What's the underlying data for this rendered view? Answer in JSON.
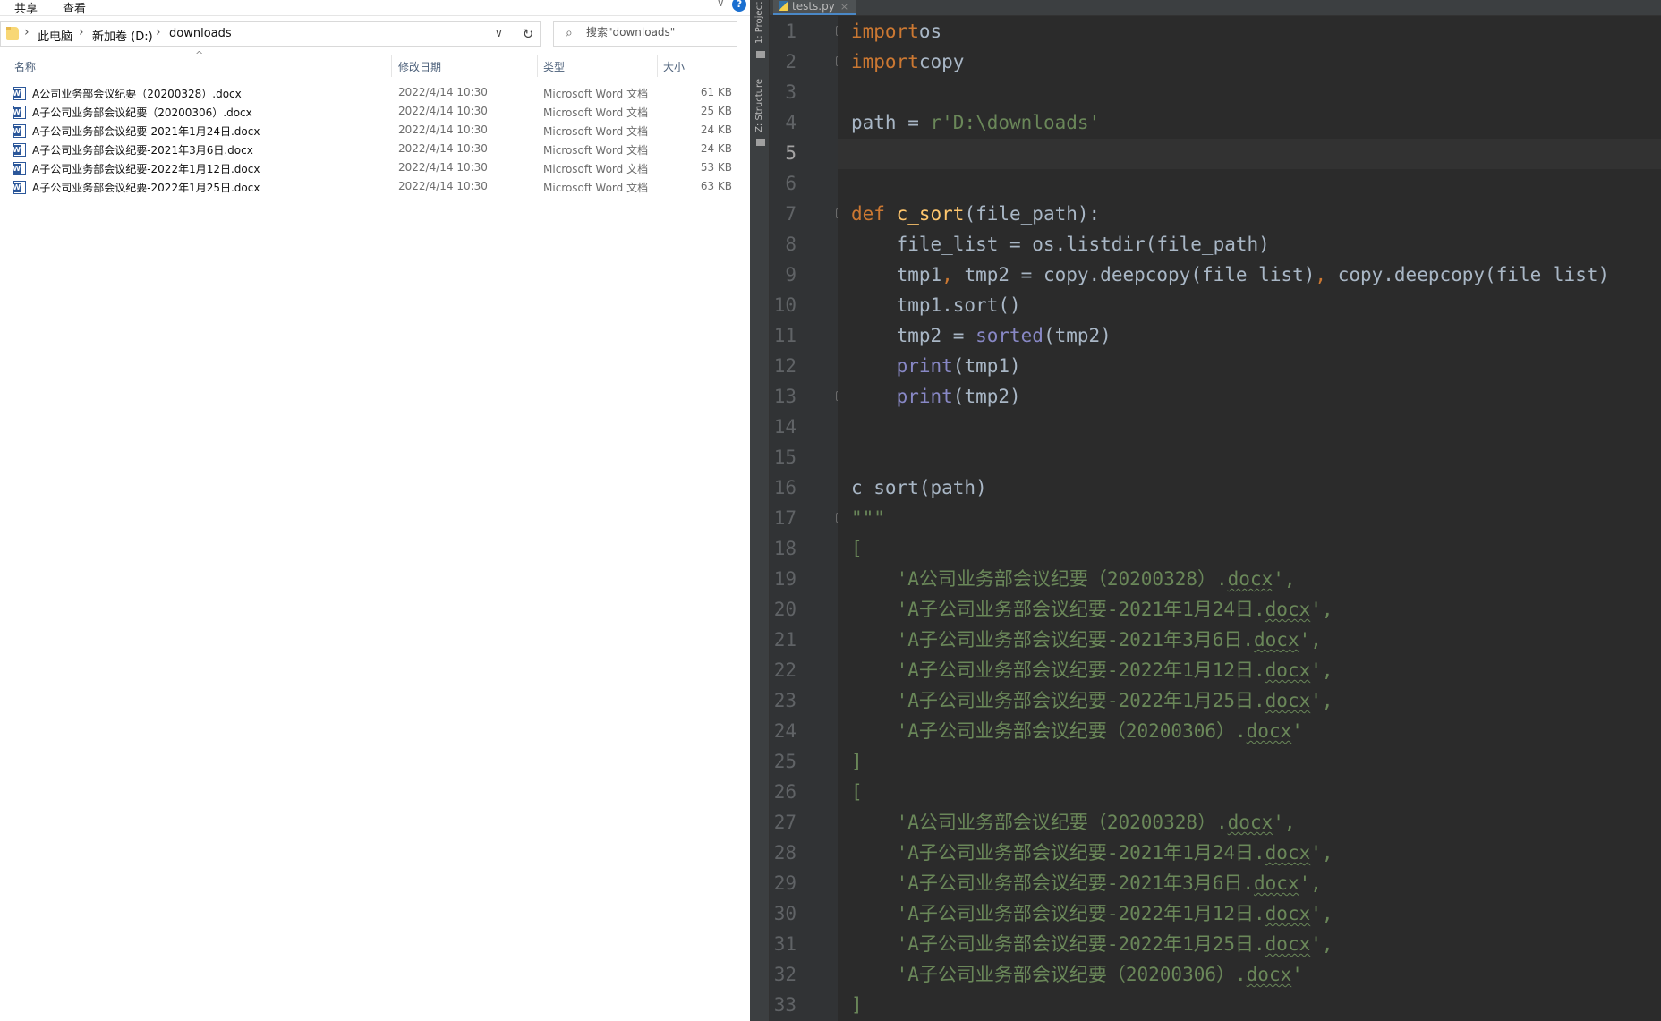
{
  "explorer": {
    "ribbon": {
      "tab_share": "共享",
      "tab_view": "查看",
      "help_glyph": "?"
    },
    "address": {
      "seg_pc": "此电脑",
      "seg_drive": "新加卷 (D:)",
      "seg_folder": "downloads"
    },
    "search": {
      "placeholder": "搜索\"downloads\""
    },
    "columns": {
      "name": "名称",
      "date": "修改日期",
      "type": "类型",
      "size": "大小"
    },
    "files": [
      {
        "name": "A公司业务部会议纪要（20200328）.docx",
        "date": "2022/4/14 10:30",
        "type": "Microsoft Word 文档",
        "size": "61 KB"
      },
      {
        "name": "A子公司业务部会议纪要（20200306）.docx",
        "date": "2022/4/14 10:30",
        "type": "Microsoft Word 文档",
        "size": "25 KB"
      },
      {
        "name": "A子公司业务部会议纪要-2021年1月24日.docx",
        "date": "2022/4/14 10:30",
        "type": "Microsoft Word 文档",
        "size": "24 KB"
      },
      {
        "name": "A子公司业务部会议纪要-2021年3月6日.docx",
        "date": "2022/4/14 10:30",
        "type": "Microsoft Word 文档",
        "size": "24 KB"
      },
      {
        "name": "A子公司业务部会议纪要-2022年1月12日.docx",
        "date": "2022/4/14 10:30",
        "type": "Microsoft Word 文档",
        "size": "53 KB"
      },
      {
        "name": "A子公司业务部会议纪要-2022年1月25日.docx",
        "date": "2022/4/14 10:30",
        "type": "Microsoft Word 文档",
        "size": "63 KB"
      }
    ]
  },
  "ide": {
    "tool_tabs": {
      "project": "1: Project",
      "structure": "Z: Structure"
    },
    "editor_tab": {
      "filename": "tests.py",
      "close_glyph": "×"
    },
    "current_line": 5,
    "code_lines": [
      [
        [
          "kw",
          "import"
        ],
        [
          "",
          "os"
        ]
      ],
      [
        [
          "kw",
          "import"
        ],
        [
          "",
          "copy"
        ]
      ],
      [],
      [
        [
          "",
          "path = "
        ],
        [
          "str",
          "r'D:\\downloads'"
        ]
      ],
      [],
      [],
      [
        [
          "kw",
          "def "
        ],
        [
          "fn",
          "c_sort"
        ],
        [
          "",
          "(file_path):"
        ]
      ],
      [
        [
          "",
          "    file_list = os.listdir(file_path)"
        ]
      ],
      [
        [
          "",
          "    tmp1"
        ],
        [
          "kw",
          ","
        ],
        [
          "",
          " tmp2 = copy.deepcopy(file_list)"
        ],
        [
          "kw",
          ","
        ],
        [
          "",
          " copy.deepcopy(file_list)"
        ]
      ],
      [
        [
          "",
          "    tmp1.sort()"
        ]
      ],
      [
        [
          "",
          "    tmp2 = "
        ],
        [
          "bi",
          "sorted"
        ],
        [
          "",
          "(tmp2)"
        ]
      ],
      [
        [
          "",
          "    "
        ],
        [
          "bi",
          "print"
        ],
        [
          "",
          "(tmp1)"
        ]
      ],
      [
        [
          "",
          "    "
        ],
        [
          "bi",
          "print"
        ],
        [
          "",
          "(tmp2)"
        ]
      ],
      [],
      [],
      [
        [
          "",
          "c_sort(path)"
        ]
      ],
      [
        [
          "str",
          "\"\"\""
        ]
      ],
      [
        [
          "str",
          "["
        ]
      ],
      [
        [
          "str",
          "    'A公司业务部会议纪要（20200328）."
        ],
        [
          "sq",
          "docx"
        ],
        [
          "str",
          "',"
        ]
      ],
      [
        [
          "str",
          "    'A子公司业务部会议纪要-2021年1月24日."
        ],
        [
          "sq",
          "docx"
        ],
        [
          "str",
          "',"
        ]
      ],
      [
        [
          "str",
          "    'A子公司业务部会议纪要-2021年3月6日."
        ],
        [
          "sq",
          "docx"
        ],
        [
          "str",
          "',"
        ]
      ],
      [
        [
          "str",
          "    'A子公司业务部会议纪要-2022年1月12日."
        ],
        [
          "sq",
          "docx"
        ],
        [
          "str",
          "',"
        ]
      ],
      [
        [
          "str",
          "    'A子公司业务部会议纪要-2022年1月25日."
        ],
        [
          "sq",
          "docx"
        ],
        [
          "str",
          "',"
        ]
      ],
      [
        [
          "str",
          "    'A子公司业务部会议纪要（20200306）."
        ],
        [
          "sq",
          "docx"
        ],
        [
          "str",
          "'"
        ]
      ],
      [
        [
          "str",
          "]"
        ]
      ],
      [
        [
          "str",
          "["
        ]
      ],
      [
        [
          "str",
          "    'A公司业务部会议纪要（20200328）."
        ],
        [
          "sq",
          "docx"
        ],
        [
          "str",
          "',"
        ]
      ],
      [
        [
          "str",
          "    'A子公司业务部会议纪要-2021年1月24日."
        ],
        [
          "sq",
          "docx"
        ],
        [
          "str",
          "',"
        ]
      ],
      [
        [
          "str",
          "    'A子公司业务部会议纪要-2021年3月6日."
        ],
        [
          "sq",
          "docx"
        ],
        [
          "str",
          "',"
        ]
      ],
      [
        [
          "str",
          "    'A子公司业务部会议纪要-2022年1月12日."
        ],
        [
          "sq",
          "docx"
        ],
        [
          "str",
          "',"
        ]
      ],
      [
        [
          "str",
          "    'A子公司业务部会议纪要-2022年1月25日."
        ],
        [
          "sq",
          "docx"
        ],
        [
          "str",
          "',"
        ]
      ],
      [
        [
          "str",
          "    'A子公司业务部会议纪要（20200306）."
        ],
        [
          "sq",
          "docx"
        ],
        [
          "str",
          "'"
        ]
      ],
      [
        [
          "str",
          "]"
        ]
      ]
    ],
    "fold_lines": [
      1,
      2,
      7,
      13,
      17
    ]
  }
}
